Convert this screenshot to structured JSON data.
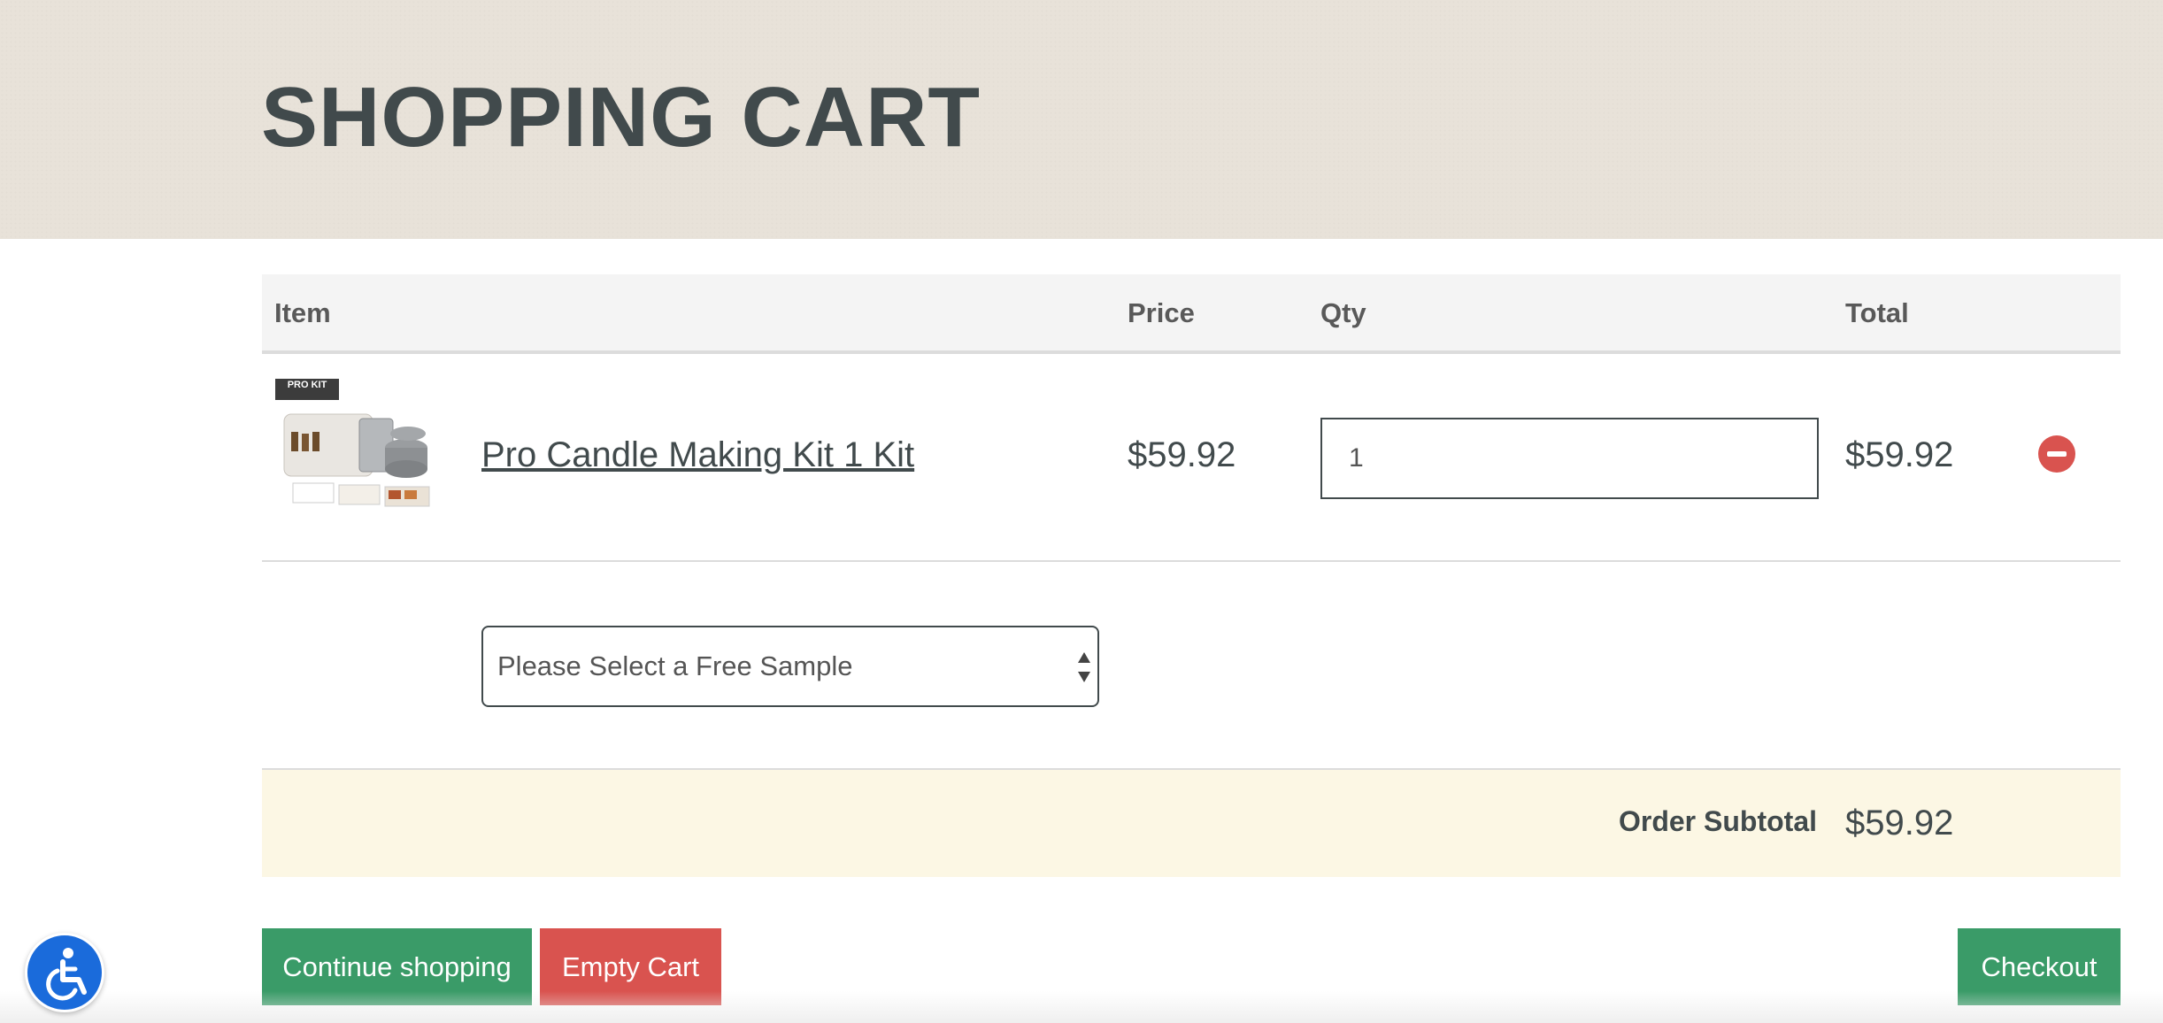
{
  "page": {
    "title": "SHOPPING CART"
  },
  "table": {
    "headers": {
      "item": "Item",
      "price": "Price",
      "qty": "Qty",
      "total": "Total"
    },
    "rows": [
      {
        "thumb_label": "PRO KIT",
        "name": "Pro Candle Making Kit 1 Kit",
        "price": "$59.92",
        "qty": "1",
        "total": "$59.92"
      }
    ]
  },
  "free_sample": {
    "placeholder": "Please Select a Free Sample"
  },
  "summary": {
    "subtotal_label": "Order Subtotal",
    "subtotal_value": "$59.92"
  },
  "buttons": {
    "continue": "Continue shopping",
    "empty": "Empty Cart",
    "checkout": "Checkout"
  },
  "colors": {
    "hero_bg": "#e8e2d9",
    "primary_green": "#3a9b68",
    "danger_red": "#d9534f",
    "subtotal_bg": "#fcf7e4",
    "accessibility_blue": "#1a6bdb"
  },
  "icons": {
    "remove": "remove-circle-icon",
    "accessibility": "accessibility-icon"
  }
}
